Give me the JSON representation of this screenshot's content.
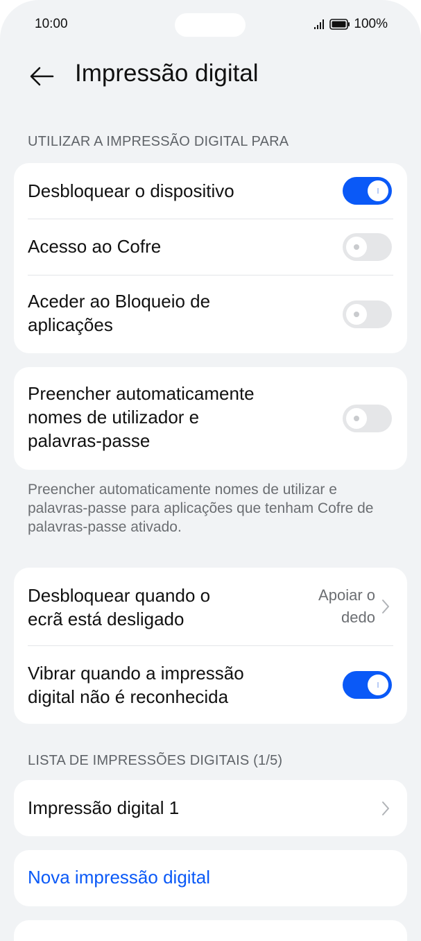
{
  "status_bar": {
    "time": "10:00",
    "battery": "100%"
  },
  "header": {
    "title": "Impressão digital"
  },
  "use_section": {
    "label": "UTILIZAR A IMPRESSÃO DIGITAL PARA",
    "items": [
      {
        "label": "Desbloquear o dispositivo",
        "enabled": true
      },
      {
        "label": "Acesso ao Cofre",
        "enabled": false
      },
      {
        "label": "Aceder ao Bloqueio de\naplicações",
        "enabled": false
      }
    ]
  },
  "autofill": {
    "label": "Preencher automaticamente\nnomes de utilizador e\npalavras-passe",
    "enabled": false,
    "description": "Preencher automaticamente nomes de utilizar e palavras-passe para aplicações que tenham Cofre de palavras-passe ativado."
  },
  "screen_off": {
    "label": "Desbloquear quando o\necrã está desligado",
    "value": "Apoiar o\ndedo"
  },
  "vibrate": {
    "label": "Vibrar quando a impressão\ndigital não é reconhecida",
    "enabled": true
  },
  "fingerprint_list": {
    "label": "LISTA DE IMPRESSÕES DIGITAIS (1/5)",
    "items": [
      {
        "label": "Impressão digital 1"
      }
    ],
    "new_label": "Nova impressão digital"
  },
  "colors": {
    "accent": "#0a59f7",
    "background": "#f1f3f5",
    "card": "#ffffff",
    "toggle_off": "#e5e6e8"
  }
}
